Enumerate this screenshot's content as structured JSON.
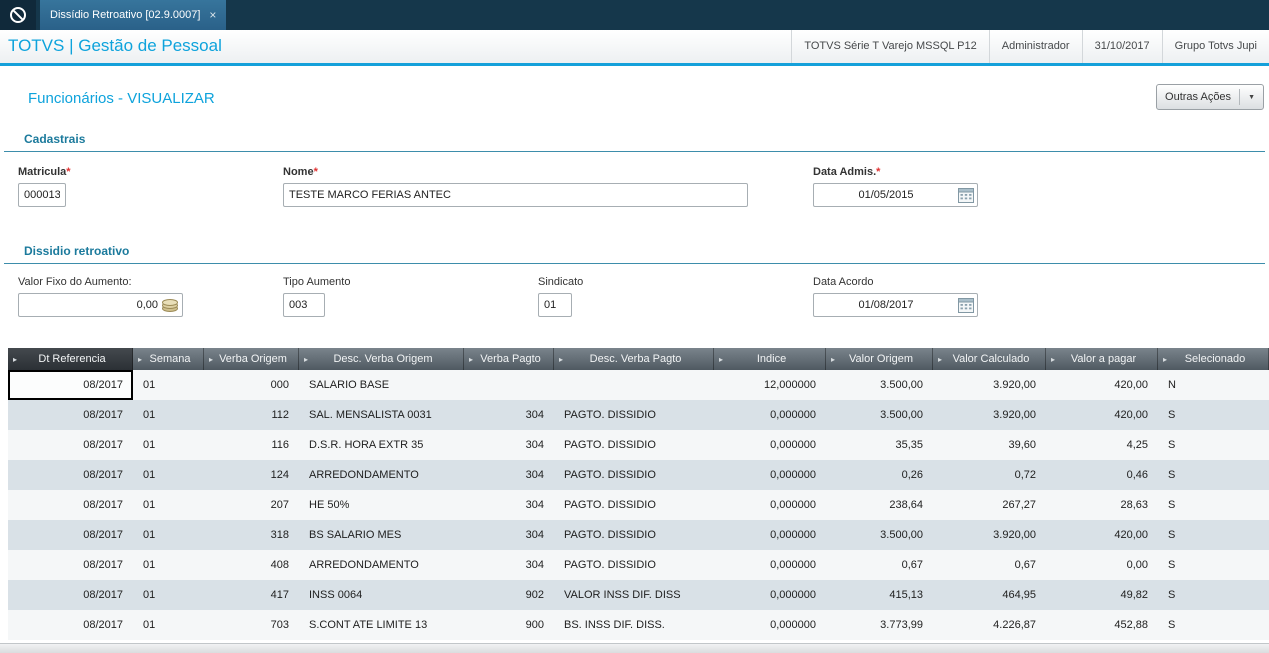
{
  "topbar": {
    "tab_label": "Dissídio Retroativo [02.9.0007]",
    "tab_close": "×"
  },
  "header": {
    "brand": "TOTVS | Gestão de Pessoal",
    "environment": "TOTVS Série T Varejo MSSQL P12",
    "user": "Administrador",
    "date": "31/10/2017",
    "group": "Grupo Totvs Jupi"
  },
  "page": {
    "title": "Funcionários - VISUALIZAR",
    "other_actions_label": "Outras Ações"
  },
  "required_marker": "*",
  "cadastrais": {
    "title": "Cadastrais",
    "matricula": {
      "label": "Matricula",
      "value": "000013"
    },
    "nome": {
      "label": "Nome",
      "value": "TESTE MARCO FERIAS ANTEC"
    },
    "data_admissao": {
      "label": "Data Admis.",
      "value": "01/05/2015"
    }
  },
  "dissidio": {
    "title": "Dissidio retroativo",
    "valor_fixo": {
      "label": "Valor Fixo do Aumento:",
      "value": "0,00"
    },
    "tipo_aumento": {
      "label": "Tipo Aumento",
      "value": "003"
    },
    "sindicato": {
      "label": "Sindicato",
      "value": "01"
    },
    "data_acordo": {
      "label": "Data Acordo",
      "value": "01/08/2017"
    }
  },
  "grid": {
    "columns": [
      "Dt Referencia",
      "Semana",
      "Verba Origem",
      "Desc. Verba Origem",
      "Verba Pagto",
      "Desc. Verba Pagto",
      "Indice",
      "Valor Origem",
      "Valor Calculado",
      "Valor a pagar",
      "Selecionado"
    ],
    "rows": [
      [
        "08/2017",
        "01",
        "000",
        "SALARIO BASE",
        "",
        "",
        "12,000000",
        "3.500,00",
        "3.920,00",
        "420,00",
        "N"
      ],
      [
        "08/2017",
        "01",
        "112",
        "SAL. MENSALISTA 0031",
        "304",
        "PAGTO. DISSIDIO",
        "0,000000",
        "3.500,00",
        "3.920,00",
        "420,00",
        "S"
      ],
      [
        "08/2017",
        "01",
        "116",
        "D.S.R. HORA EXTR 35",
        "304",
        "PAGTO. DISSIDIO",
        "0,000000",
        "35,35",
        "39,60",
        "4,25",
        "S"
      ],
      [
        "08/2017",
        "01",
        "124",
        "ARREDONDAMENTO",
        "304",
        "PAGTO. DISSIDIO",
        "0,000000",
        "0,26",
        "0,72",
        "0,46",
        "S"
      ],
      [
        "08/2017",
        "01",
        "207",
        "HE  50%",
        "304",
        "PAGTO. DISSIDIO",
        "0,000000",
        "238,64",
        "267,27",
        "28,63",
        "S"
      ],
      [
        "08/2017",
        "01",
        "318",
        "BS SALARIO MES",
        "304",
        "PAGTO. DISSIDIO",
        "0,000000",
        "3.500,00",
        "3.920,00",
        "420,00",
        "S"
      ],
      [
        "08/2017",
        "01",
        "408",
        "ARREDONDAMENTO",
        "304",
        "PAGTO. DISSIDIO",
        "0,000000",
        "0,67",
        "0,67",
        "0,00",
        "S"
      ],
      [
        "08/2017",
        "01",
        "417",
        "INSS 0064",
        "902",
        "VALOR INSS DIF. DISS",
        "0,000000",
        "415,13",
        "464,95",
        "49,82",
        "S"
      ],
      [
        "08/2017",
        "01",
        "703",
        "S.CONT ATE LIMITE 13",
        "900",
        "BS. INSS DIF. DISS.",
        "0,000000",
        "3.773,99",
        "4.226,87",
        "452,88",
        "S"
      ]
    ]
  }
}
